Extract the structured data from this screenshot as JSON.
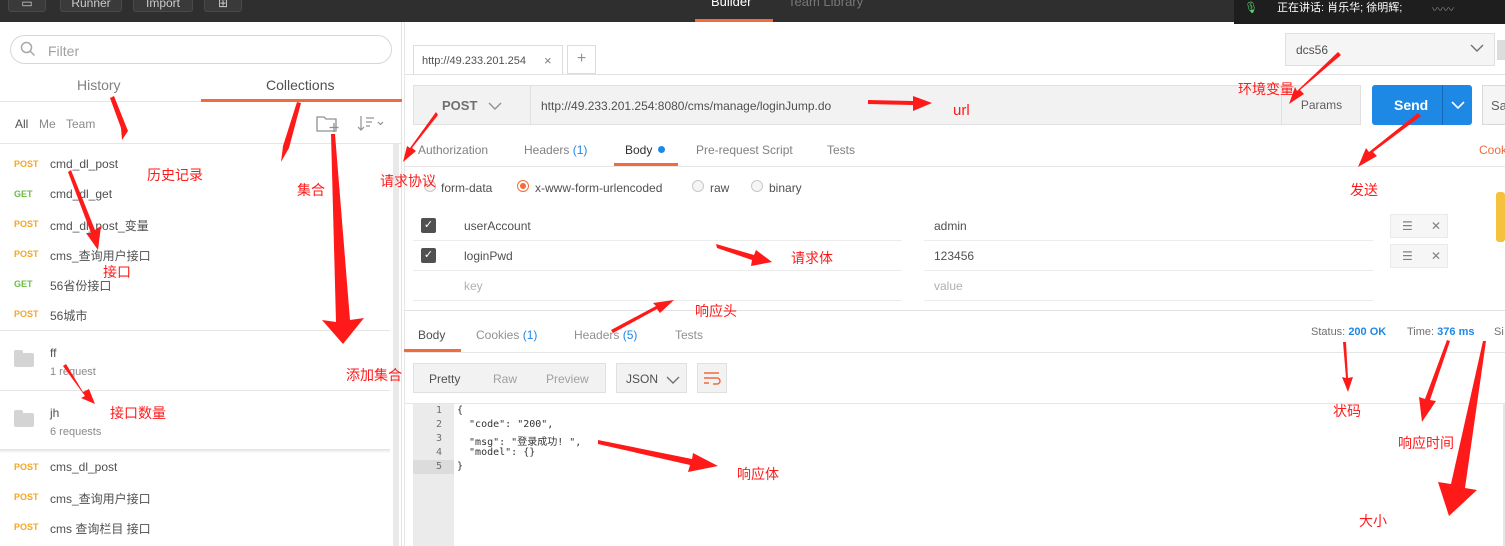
{
  "topbar": {
    "runner": "Runner",
    "import": "Import",
    "tab_builder": "Builder",
    "tab_team_library": "Team Library",
    "meeting_text": "正在讲话: 肖乐华; 徐明辉;"
  },
  "sidebar": {
    "filter_placeholder": "Filter",
    "tab_history": "History",
    "tab_collections": "Collections",
    "owner_all": "All",
    "owner_me": "Me",
    "owner_team": "Team",
    "requests_top": [
      {
        "method": "POST",
        "name": "cmd_dl_post"
      },
      {
        "method": "GET",
        "name": "cmd_dl_get"
      },
      {
        "method": "POST",
        "name": "cmd_dl_post_变量"
      },
      {
        "method": "POST",
        "name": "cms_查询用户接口"
      },
      {
        "method": "GET",
        "name": "56省份接口"
      },
      {
        "method": "POST",
        "name": "56城市"
      }
    ],
    "collections": [
      {
        "name": "ff",
        "count": "1 request"
      },
      {
        "name": "jh",
        "count": "6 requests"
      }
    ],
    "requests_bottom": [
      {
        "method": "POST",
        "name": "cms_dl_post"
      },
      {
        "method": "POST",
        "name": "cms_查询用户接口"
      },
      {
        "method": "POST",
        "name": "cms 查询栏目 接口"
      }
    ]
  },
  "request_tab": {
    "label": "http://49.233.201.254",
    "close": "×",
    "new": "+"
  },
  "environment": {
    "selected": "dcs56"
  },
  "request": {
    "method": "POST",
    "url": "http://49.233.201.254:8080/cms/manage/loginJump.do",
    "params_label": "Params",
    "send_label": "Send",
    "save_label": "Sa"
  },
  "subtabs": {
    "authorization": "Authorization",
    "headers": "Headers",
    "headers_count": "(1)",
    "body": "Body",
    "prerequest": "Pre-request Script",
    "tests": "Tests",
    "cookies": "Cook"
  },
  "body_modes": {
    "form_data": "form-data",
    "urlencoded": "x-www-form-urlencoded",
    "raw": "raw",
    "binary": "binary"
  },
  "params": [
    {
      "key": "userAccount",
      "value": "admin"
    },
    {
      "key": "loginPwd",
      "value": "123456"
    }
  ],
  "params_placeholder": {
    "key": "key",
    "value": "value"
  },
  "response": {
    "tab_body": "Body",
    "tab_cookies": "Cookies",
    "cookies_count": "(1)",
    "tab_headers": "Headers",
    "headers_count": "(5)",
    "tab_tests": "Tests",
    "status_label": "Status:",
    "status_value": "200 OK",
    "time_label": "Time:",
    "time_value": "376 ms",
    "size_label": "Si",
    "fmt_pretty": "Pretty",
    "fmt_raw": "Raw",
    "fmt_preview": "Preview",
    "fmt_type": "JSON",
    "code_lines": [
      "{",
      "  \"code\": \"200\",",
      "  \"msg\": \"登录成功! \",",
      "  \"model\": {}",
      "}"
    ],
    "line_numbers": [
      "1",
      "2",
      "3",
      "4",
      "5"
    ]
  },
  "annotations": {
    "history": "历史记录",
    "collection": "集合",
    "interface": "接口",
    "add_collection": "添加集合",
    "interface_count": "接口数量",
    "protocol": "请求协议",
    "url": "url",
    "request_body": "请求体",
    "response_header": "响应头",
    "response_body": "响应体",
    "env_var": "环境变量",
    "send": "发送",
    "status_code": "状码",
    "response_time": "响应时间",
    "size": "大小"
  },
  "colors": {
    "accent": "#f26b3a",
    "send_blue": "#1e88e5",
    "annotation_red": "#ff1a1a",
    "post": "#f5a623",
    "get": "#6bbd45"
  }
}
